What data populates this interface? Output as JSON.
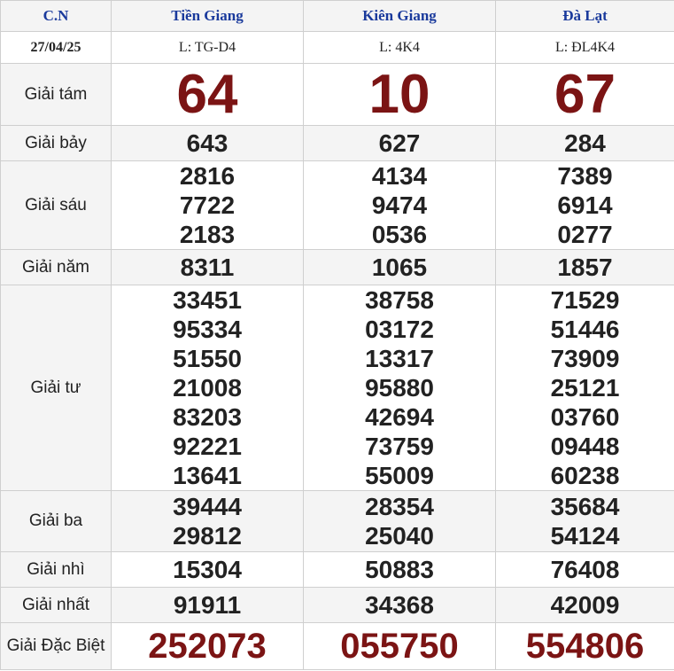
{
  "header": {
    "day": "C.N",
    "provinces": [
      "Tiền Giang",
      "Kiên Giang",
      "Đà Lạt"
    ]
  },
  "date": "27/04/25",
  "codes": [
    "L: TG-D4",
    "L: 4K4",
    "L: ĐL4K4"
  ],
  "prizes": {
    "g8": {
      "label": "Giải tám",
      "values": [
        "64",
        "10",
        "67"
      ]
    },
    "g7": {
      "label": "Giải bảy",
      "values": [
        "643",
        "627",
        "284"
      ]
    },
    "g6": {
      "label": "Giải sáu",
      "values": [
        [
          "2816",
          "7722",
          "2183"
        ],
        [
          "4134",
          "9474",
          "0536"
        ],
        [
          "7389",
          "6914",
          "0277"
        ]
      ]
    },
    "g5": {
      "label": "Giải năm",
      "values": [
        "8311",
        "1065",
        "1857"
      ]
    },
    "g4": {
      "label": "Giải tư",
      "values": [
        [
          "33451",
          "95334",
          "51550",
          "21008",
          "83203",
          "92221",
          "13641"
        ],
        [
          "38758",
          "03172",
          "13317",
          "95880",
          "42694",
          "73759",
          "55009"
        ],
        [
          "71529",
          "51446",
          "73909",
          "25121",
          "03760",
          "09448",
          "60238"
        ]
      ]
    },
    "g3": {
      "label": "Giải ba",
      "values": [
        [
          "39444",
          "29812"
        ],
        [
          "28354",
          "25040"
        ],
        [
          "35684",
          "54124"
        ]
      ]
    },
    "g2": {
      "label": "Giải nhì",
      "values": [
        "15304",
        "50883",
        "76408"
      ]
    },
    "g1": {
      "label": "Giải nhất",
      "values": [
        "91911",
        "34368",
        "42009"
      ]
    },
    "db": {
      "label": "Giải Đặc Biệt",
      "values": [
        "252073",
        "055750",
        "554806"
      ]
    }
  },
  "colors": {
    "header_text": "#1a3a9c",
    "highlight_number": "#7b1414",
    "grid": "#cfcfcf",
    "stripe": "#f4f4f4"
  }
}
